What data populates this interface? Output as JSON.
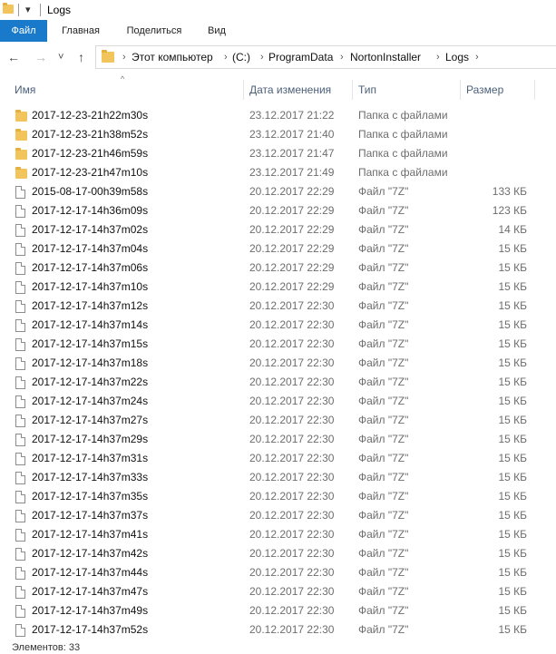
{
  "window": {
    "title": "Logs",
    "quick_access_icon": "▾"
  },
  "ribbon": {
    "tabs": [
      "Файл",
      "Главная",
      "Поделиться",
      "Вид"
    ]
  },
  "nav": {
    "back": "←",
    "forward": "→",
    "recent": "˅",
    "up": "↑"
  },
  "address": {
    "crumbs": [
      "Этот компьютер",
      "(C:)",
      "ProgramData",
      "NortonInstaller",
      "Logs"
    ],
    "separator": "›"
  },
  "columns": {
    "name": "Имя",
    "date": "Дата изменения",
    "type": "Тип",
    "size": "Размер",
    "sort_indicator": "^"
  },
  "files": [
    {
      "icon": "folder-icon",
      "name": "2017-12-23-21h22m30s",
      "date": "23.12.2017 21:22",
      "type": "Папка с файлами",
      "size": ""
    },
    {
      "icon": "folder-icon",
      "name": "2017-12-23-21h38m52s",
      "date": "23.12.2017 21:40",
      "type": "Папка с файлами",
      "size": ""
    },
    {
      "icon": "folder-icon",
      "name": "2017-12-23-21h46m59s",
      "date": "23.12.2017 21:47",
      "type": "Папка с файлами",
      "size": ""
    },
    {
      "icon": "folder-icon",
      "name": "2017-12-23-21h47m10s",
      "date": "23.12.2017 21:49",
      "type": "Папка с файлами",
      "size": ""
    },
    {
      "icon": "file-icon",
      "name": "2015-08-17-00h39m58s",
      "date": "20.12.2017 22:29",
      "type": "Файл \"7Z\"",
      "size": "133 КБ"
    },
    {
      "icon": "file-icon",
      "name": "2017-12-17-14h36m09s",
      "date": "20.12.2017 22:29",
      "type": "Файл \"7Z\"",
      "size": "123 КБ"
    },
    {
      "icon": "file-icon",
      "name": "2017-12-17-14h37m02s",
      "date": "20.12.2017 22:29",
      "type": "Файл \"7Z\"",
      "size": "14 КБ"
    },
    {
      "icon": "file-icon",
      "name": "2017-12-17-14h37m04s",
      "date": "20.12.2017 22:29",
      "type": "Файл \"7Z\"",
      "size": "15 КБ"
    },
    {
      "icon": "file-icon",
      "name": "2017-12-17-14h37m06s",
      "date": "20.12.2017 22:29",
      "type": "Файл \"7Z\"",
      "size": "15 КБ"
    },
    {
      "icon": "file-icon",
      "name": "2017-12-17-14h37m10s",
      "date": "20.12.2017 22:29",
      "type": "Файл \"7Z\"",
      "size": "15 КБ"
    },
    {
      "icon": "file-icon",
      "name": "2017-12-17-14h37m12s",
      "date": "20.12.2017 22:30",
      "type": "Файл \"7Z\"",
      "size": "15 КБ"
    },
    {
      "icon": "file-icon",
      "name": "2017-12-17-14h37m14s",
      "date": "20.12.2017 22:30",
      "type": "Файл \"7Z\"",
      "size": "15 КБ"
    },
    {
      "icon": "file-icon",
      "name": "2017-12-17-14h37m15s",
      "date": "20.12.2017 22:30",
      "type": "Файл \"7Z\"",
      "size": "15 КБ"
    },
    {
      "icon": "file-icon",
      "name": "2017-12-17-14h37m18s",
      "date": "20.12.2017 22:30",
      "type": "Файл \"7Z\"",
      "size": "15 КБ"
    },
    {
      "icon": "file-icon",
      "name": "2017-12-17-14h37m22s",
      "date": "20.12.2017 22:30",
      "type": "Файл \"7Z\"",
      "size": "15 КБ"
    },
    {
      "icon": "file-icon",
      "name": "2017-12-17-14h37m24s",
      "date": "20.12.2017 22:30",
      "type": "Файл \"7Z\"",
      "size": "15 КБ"
    },
    {
      "icon": "file-icon",
      "name": "2017-12-17-14h37m27s",
      "date": "20.12.2017 22:30",
      "type": "Файл \"7Z\"",
      "size": "15 КБ"
    },
    {
      "icon": "file-icon",
      "name": "2017-12-17-14h37m29s",
      "date": "20.12.2017 22:30",
      "type": "Файл \"7Z\"",
      "size": "15 КБ"
    },
    {
      "icon": "file-icon",
      "name": "2017-12-17-14h37m31s",
      "date": "20.12.2017 22:30",
      "type": "Файл \"7Z\"",
      "size": "15 КБ"
    },
    {
      "icon": "file-icon",
      "name": "2017-12-17-14h37m33s",
      "date": "20.12.2017 22:30",
      "type": "Файл \"7Z\"",
      "size": "15 КБ"
    },
    {
      "icon": "file-icon",
      "name": "2017-12-17-14h37m35s",
      "date": "20.12.2017 22:30",
      "type": "Файл \"7Z\"",
      "size": "15 КБ"
    },
    {
      "icon": "file-icon",
      "name": "2017-12-17-14h37m37s",
      "date": "20.12.2017 22:30",
      "type": "Файл \"7Z\"",
      "size": "15 КБ"
    },
    {
      "icon": "file-icon",
      "name": "2017-12-17-14h37m41s",
      "date": "20.12.2017 22:30",
      "type": "Файл \"7Z\"",
      "size": "15 КБ"
    },
    {
      "icon": "file-icon",
      "name": "2017-12-17-14h37m42s",
      "date": "20.12.2017 22:30",
      "type": "Файл \"7Z\"",
      "size": "15 КБ"
    },
    {
      "icon": "file-icon",
      "name": "2017-12-17-14h37m44s",
      "date": "20.12.2017 22:30",
      "type": "Файл \"7Z\"",
      "size": "15 КБ"
    },
    {
      "icon": "file-icon",
      "name": "2017-12-17-14h37m47s",
      "date": "20.12.2017 22:30",
      "type": "Файл \"7Z\"",
      "size": "15 КБ"
    },
    {
      "icon": "file-icon",
      "name": "2017-12-17-14h37m49s",
      "date": "20.12.2017 22:30",
      "type": "Файл \"7Z\"",
      "size": "15 КБ"
    },
    {
      "icon": "file-icon",
      "name": "2017-12-17-14h37m52s",
      "date": "20.12.2017 22:30",
      "type": "Файл \"7Z\"",
      "size": "15 КБ"
    }
  ],
  "status": {
    "item_count": "Элементов: 33"
  }
}
